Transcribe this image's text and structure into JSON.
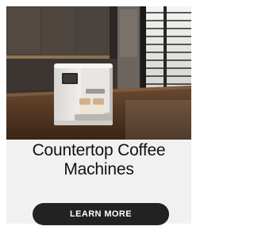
{
  "card": {
    "image_alt": "Countertop coffee machine on a kitchen counter",
    "title": "Countertop Coffee Machines",
    "cta_label": "LEARN MORE"
  }
}
